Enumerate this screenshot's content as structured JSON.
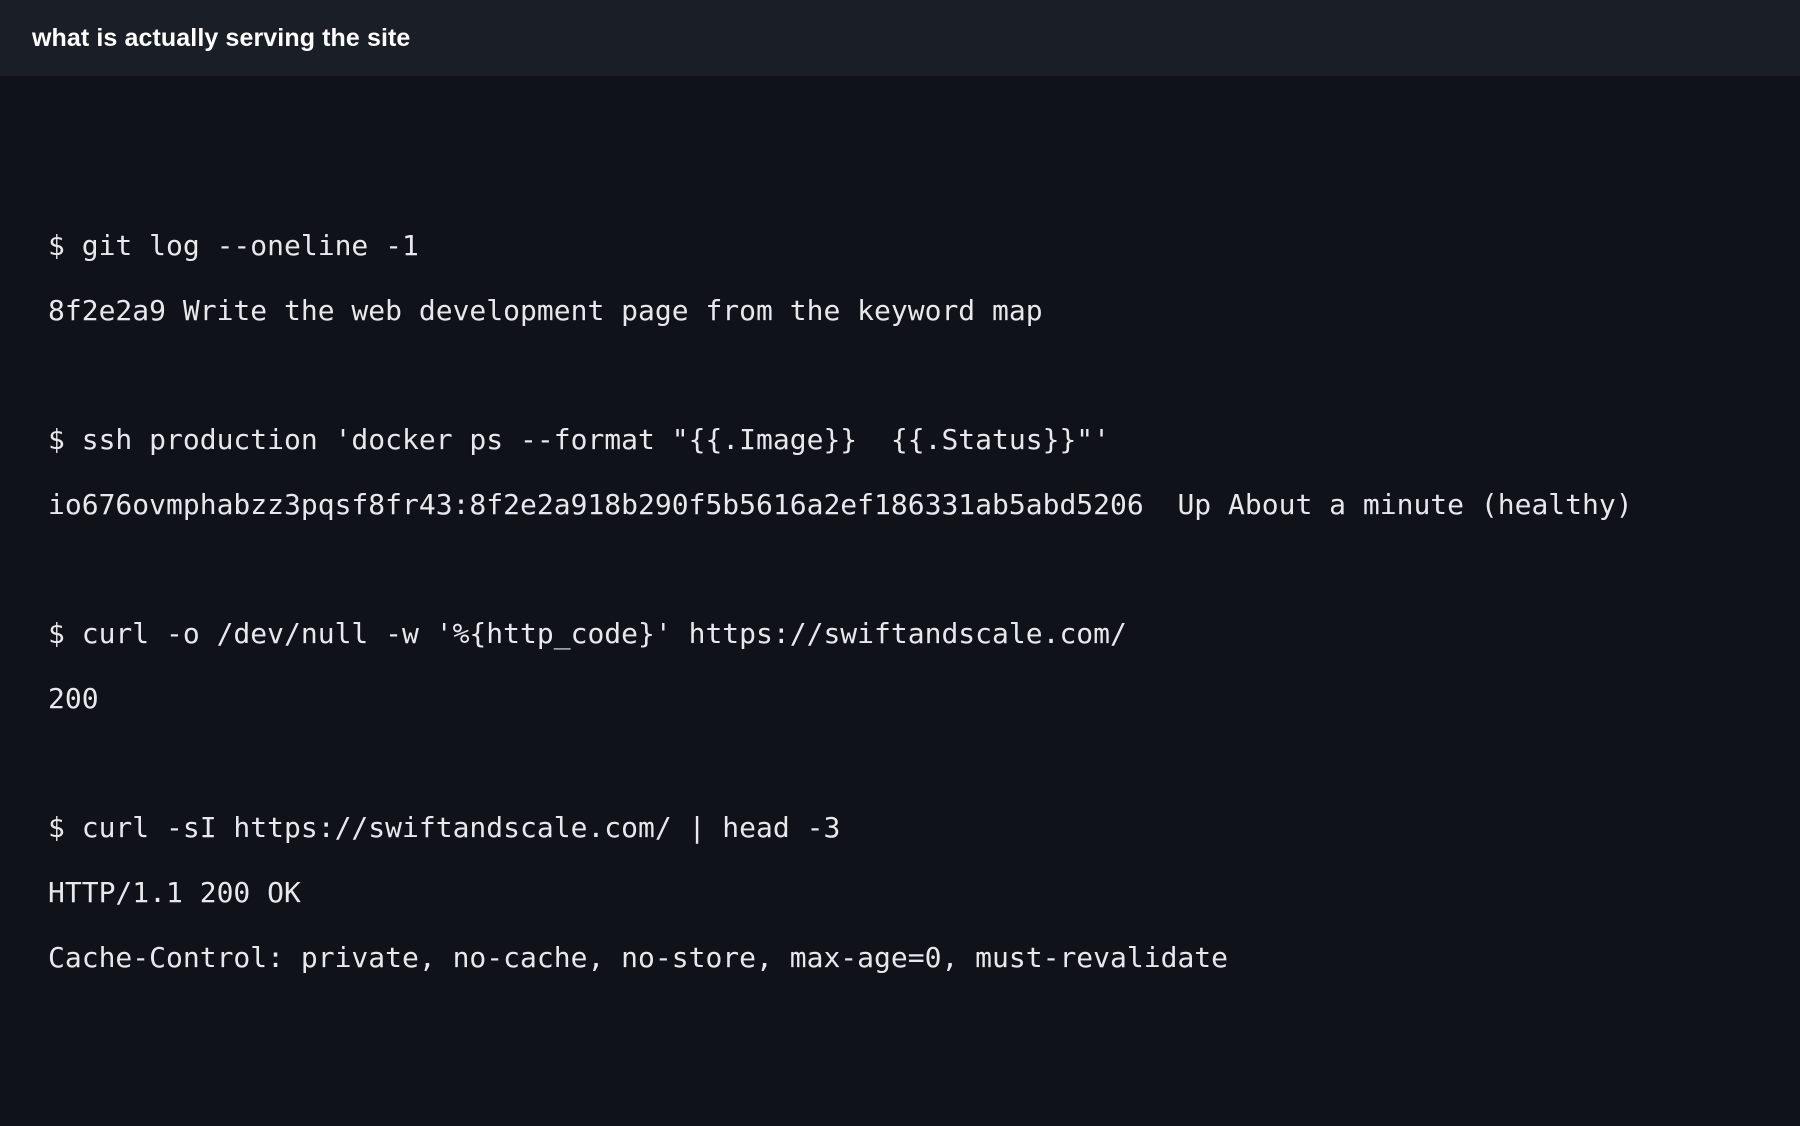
{
  "window": {
    "title": "what is actually serving the site"
  },
  "terminal": {
    "blocks": [
      {
        "command": "$ git log --oneline -1",
        "output": [
          "8f2e2a9 Write the web development page from the keyword map"
        ]
      },
      {
        "command": "$ ssh production 'docker ps --format \"{{.Image}}  {{.Status}}\"'",
        "output": [
          "io676ovmphabzz3pqsf8fr43:8f2e2a918b290f5b5616a2ef186331ab5abd5206  Up About a minute (healthy)"
        ]
      },
      {
        "command": "$ curl -o /dev/null -w '%{http_code}' https://swiftandscale.com/",
        "output": [
          "200"
        ]
      },
      {
        "command": "$ curl -sI https://swiftandscale.com/ | head -3",
        "output": [
          "HTTP/1.1 200 OK",
          "Cache-Control: private, no-cache, no-store, max-age=0, must-revalidate"
        ]
      }
    ]
  },
  "colors": {
    "background": "#0f1218",
    "titlebar": "#1a1f27",
    "text": "#e6e8ec"
  }
}
